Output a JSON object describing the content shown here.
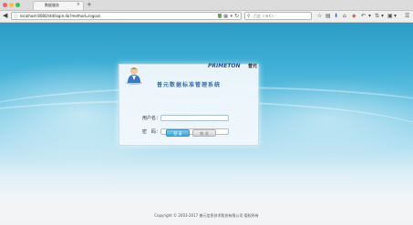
{
  "browser": {
    "tab_title": "数据服务",
    "tab_close": "×",
    "new_tab": "+",
    "url": "localhost:8080/std/login.do?method=logout",
    "search_placeholder": "百度 <⌘K>"
  },
  "page": {
    "brand_logo": "PRIMETON",
    "brand_cn": "普元",
    "system_title": "普元数据标准管理系统",
    "username_label": "用户名：",
    "password_label": "密　码：",
    "login_button": "登 录",
    "cancel_button": "取 消",
    "copyright": "Copyright © 2003-2017 普元信息技术股份有限公司 版权所有"
  },
  "colors": {
    "accent": "#3fa7d6",
    "title_blue": "#3a6ea8"
  }
}
